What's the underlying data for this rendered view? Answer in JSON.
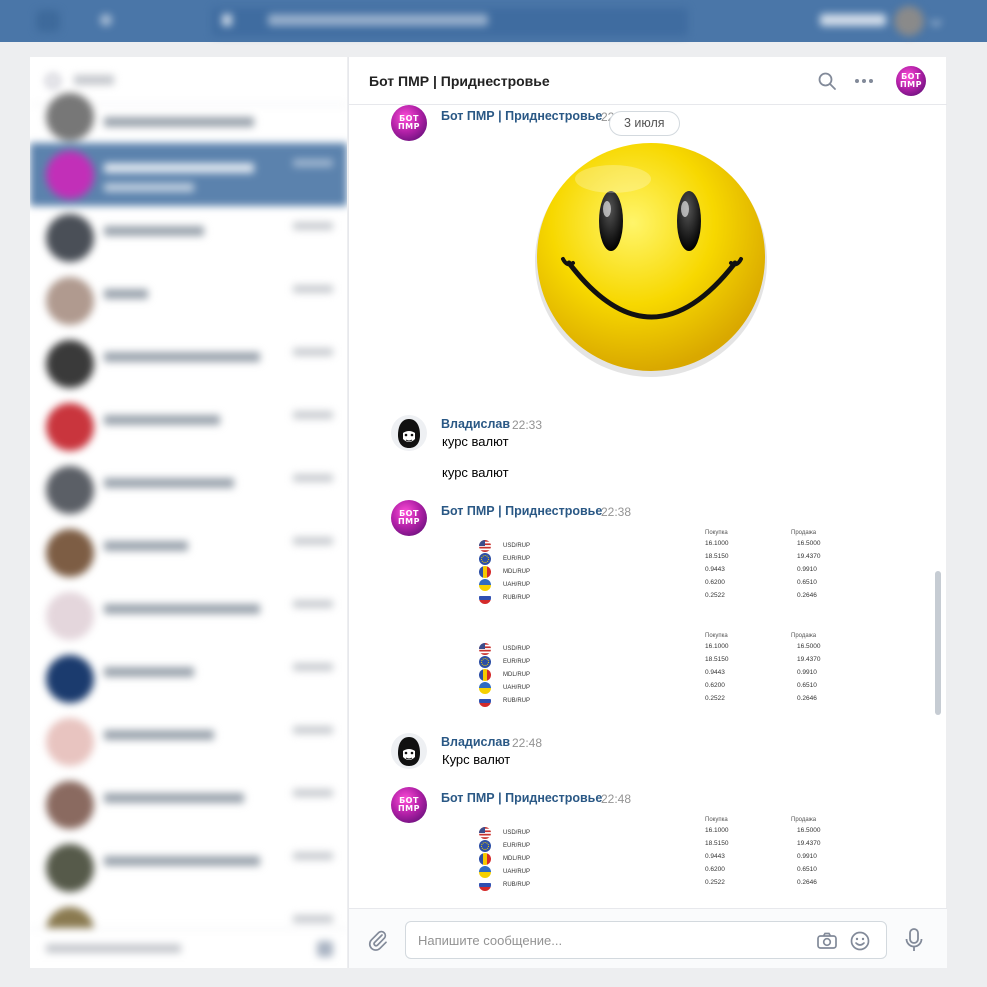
{
  "chat": {
    "title": "Бот ПМР | Приднестровье",
    "date_separator": "3 июля",
    "composer_placeholder": "Напишите сообщение..."
  },
  "bot_avatar_text": [
    "БОТ",
    "ПМР"
  ],
  "messages": [
    {
      "author": "Бот ПМР | Приднестровье",
      "time": "22",
      "content": "smiley-sticker"
    },
    {
      "author": "Владислав",
      "time": "22:33",
      "texts": [
        "курс валют",
        "курс валют"
      ]
    },
    {
      "author": "Бот ПМР | Приднестровье",
      "time": "22:38",
      "content": "rates-table x2"
    },
    {
      "author": "Владислав",
      "time": "22:48",
      "texts": [
        "Курс валют"
      ]
    },
    {
      "author": "Бот ПМР | Приднестровье",
      "time": "22:48",
      "content": "rates-table"
    }
  ],
  "rates": {
    "header_buy": "Покупка",
    "header_sell": "Продажа",
    "rows": [
      {
        "pair": "USD/RUP",
        "flag": "us-flag",
        "buy": "16.1000",
        "sell": "16.5000"
      },
      {
        "pair": "EUR/RUP",
        "flag": "eu-flag",
        "buy": "18.5150",
        "sell": "19.4370"
      },
      {
        "pair": "MDL/RUP",
        "flag": "md-flag",
        "buy": "0.9443",
        "sell": "0.9910"
      },
      {
        "pair": "UAH/RUP",
        "flag": "ua-flag",
        "buy": "0.6200",
        "sell": "0.6510"
      },
      {
        "pair": "RUB/RUP",
        "flag": "ru-flag",
        "buy": "0.2522",
        "sell": "0.2646"
      }
    ]
  },
  "colors": {
    "header": "#4a76a8",
    "link": "#2a5885",
    "active_dialog": "#5b82ad"
  }
}
